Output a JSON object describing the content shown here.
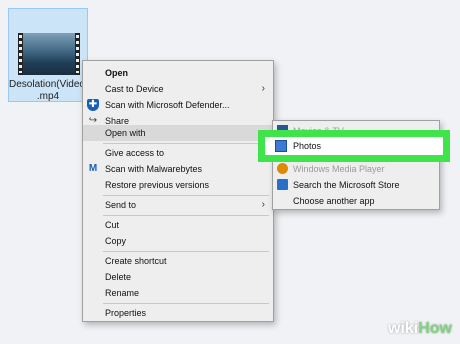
{
  "file": {
    "name": "Desolation(Video)\n.mp4"
  },
  "context_menu": {
    "items": [
      {
        "label": "Open"
      },
      {
        "label": "Cast to Device"
      },
      {
        "label": "Scan with Microsoft Defender..."
      },
      {
        "label": "Share"
      },
      {
        "label": "Open with"
      },
      {
        "label": "Give access to"
      },
      {
        "label": "Scan with Malwarebytes"
      },
      {
        "label": "Restore previous versions"
      },
      {
        "label": "Send to"
      },
      {
        "label": "Cut"
      },
      {
        "label": "Copy"
      },
      {
        "label": "Create shortcut"
      },
      {
        "label": "Delete"
      },
      {
        "label": "Rename"
      },
      {
        "label": "Properties"
      }
    ]
  },
  "submenu": {
    "items": [
      {
        "label": "Movies & TV"
      },
      {
        "label": "Photos"
      },
      {
        "label": "Windows Media Player"
      },
      {
        "label": "Search the Microsoft Store"
      },
      {
        "label": "Choose another app"
      }
    ]
  },
  "watermark": {
    "wiki": "wiki",
    "how": "How"
  },
  "colors": {
    "highlight": "#3fe34a",
    "selection": "#cce4f7"
  }
}
